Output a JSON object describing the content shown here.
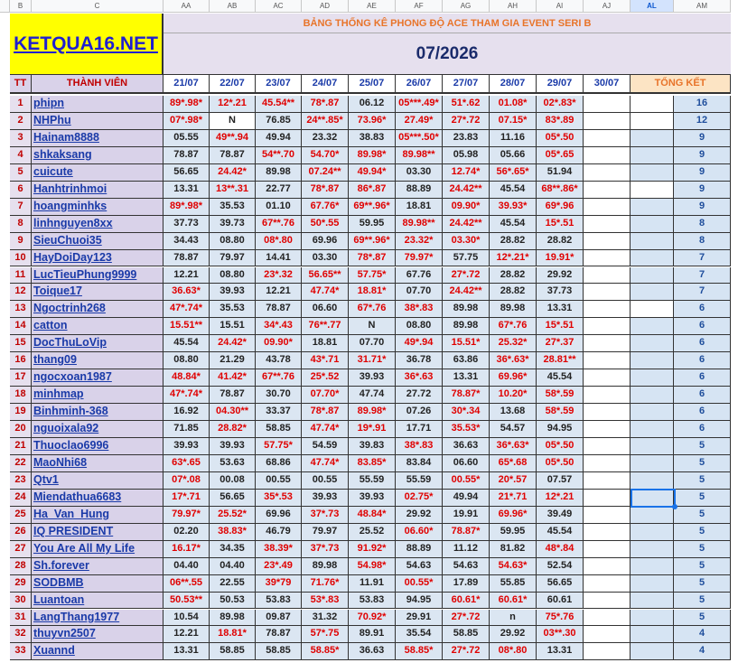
{
  "column_headers": [
    "B",
    "C",
    "AA",
    "AB",
    "AC",
    "AD",
    "AE",
    "AF",
    "AG",
    "AH",
    "AI",
    "AJ",
    "AL",
    "AM"
  ],
  "logo": "KETQUA16.NET",
  "title": "BẢNG THỐNG KÊ PHONG ĐỘ ACE THAM GIA EVENT SERI B",
  "month": "07/2026",
  "headers": {
    "tt": "TT",
    "member": "THÀNH VIÊN",
    "dates": [
      "21/07",
      "22/07",
      "23/07",
      "24/07",
      "25/07",
      "26/07",
      "27/07",
      "28/07",
      "29/07",
      "30/07"
    ],
    "total": "TỔNG KẾT"
  },
  "rows": [
    {
      "tt": "1",
      "name": "phipn",
      "vals": [
        "89*.98*",
        "12*.21",
        "45.54**",
        "78*.87",
        "06.12",
        "05***.49*",
        "51*.62",
        "01.08*",
        "02*.83*",
        ""
      ],
      "total": "16"
    },
    {
      "tt": "2",
      "name": "NHPhu",
      "vals": [
        "07*.98*",
        "N",
        "76.85",
        "24**.85*",
        "73.96*",
        "27.49*",
        "27*.72",
        "07.15*",
        "83*.89",
        ""
      ],
      "total": "12"
    },
    {
      "tt": "3",
      "name": "Hainam8888",
      "vals": [
        "05.55",
        "49**.94",
        "49.94",
        "23.32",
        "38.83",
        "05***.50*",
        "23.83",
        "11.16",
        "05*.50",
        ""
      ],
      "total": "9"
    },
    {
      "tt": "4",
      "name": "shkaksang",
      "vals": [
        "78.87",
        "78.87",
        "54**.70",
        "54.70*",
        "89.98*",
        "89.98**",
        "05.98",
        "05.66",
        "05*.65",
        ""
      ],
      "total": "9"
    },
    {
      "tt": "5",
      "name": "cuicute",
      "vals": [
        "56.65",
        "24.42*",
        "89.98",
        "07.24**",
        "49.94*",
        "03.30",
        "12.74*",
        "56*.65*",
        "51.94",
        ""
      ],
      "total": "9"
    },
    {
      "tt": "6",
      "name": "Hanhtrinhmoi",
      "vals": [
        "13.31",
        "13**.31",
        "22.77",
        "78*.87",
        "86*.87",
        "88.89",
        "24.42**",
        "45.54",
        "68**.86*",
        ""
      ],
      "total": "9"
    },
    {
      "tt": "7",
      "name": "hoangminhks",
      "vals": [
        "89*.98*",
        "35.53",
        "01.10",
        "67.76*",
        "69**.96*",
        "18.81",
        "09.90*",
        "39.93*",
        "69*.96",
        ""
      ],
      "total": "9"
    },
    {
      "tt": "8",
      "name": "linhnguyen8xx",
      "vals": [
        "37.73",
        "39.73",
        "67**.76",
        "50*.55",
        "59.95",
        "89.98**",
        "24.42**",
        "45.54",
        "15*.51",
        ""
      ],
      "total": "8"
    },
    {
      "tt": "9",
      "name": "SieuChuoi35",
      "vals": [
        "34.43",
        "08.80",
        "08*.80",
        "69.96",
        "69**.96*",
        "23.32*",
        "03.30*",
        "28.82",
        "28.82",
        ""
      ],
      "total": "8"
    },
    {
      "tt": "10",
      "name": "HayDoiDay123",
      "vals": [
        "78.87",
        "79.97",
        "14.41",
        "03.30",
        "78*.87",
        "79.97*",
        "57.75",
        "12*.21*",
        "19.91*",
        ""
      ],
      "total": "7"
    },
    {
      "tt": "11",
      "name": "LucTieuPhung9999",
      "vals": [
        "12.21",
        "08.80",
        "23*.32",
        "56.65**",
        "57.75*",
        "67.76",
        "27*.72",
        "28.82",
        "29.92",
        ""
      ],
      "total": "7"
    },
    {
      "tt": "12",
      "name": "Toique17",
      "vals": [
        "36.63*",
        "39.93",
        "12.21",
        "47.74*",
        "18.81*",
        "07.70",
        "24.42**",
        "28.82",
        "37.73",
        ""
      ],
      "total": "7"
    },
    {
      "tt": "13",
      "name": "Ngoctrinh268",
      "vals": [
        "47*.74*",
        "35.53",
        "78.87",
        "06.60",
        "67*.76",
        "38*.83",
        "89.98",
        "89.98",
        "13.31",
        ""
      ],
      "total": "6"
    },
    {
      "tt": "14",
      "name": "catton",
      "vals": [
        "15.51**",
        "15.51",
        "34*.43",
        "76**.77",
        "N",
        "08.80",
        "89.98",
        "67*.76",
        "15*.51",
        ""
      ],
      "total": "6"
    },
    {
      "tt": "15",
      "name": "DocThuLoVip",
      "vals": [
        "45.54",
        "24.42*",
        "09.90*",
        "18.81",
        "07.70",
        "49*.94",
        "15.51*",
        "25.32*",
        "27*.37",
        ""
      ],
      "total": "6"
    },
    {
      "tt": "16",
      "name": "thang09",
      "vals": [
        "08.80",
        "21.29",
        "43.78",
        "43*.71",
        "31.71*",
        "36.78",
        "63.86",
        "36*.63*",
        "28.81**",
        ""
      ],
      "total": "6"
    },
    {
      "tt": "17",
      "name": "ngocxoan1987",
      "vals": [
        "48.84*",
        "41.42*",
        "67**.76",
        "25*.52",
        "39.93",
        "36*.63",
        "13.31",
        "69.96*",
        "45.54",
        ""
      ],
      "total": "6"
    },
    {
      "tt": "18",
      "name": "minhmap",
      "vals": [
        "47*.74*",
        "78.87",
        "30.70",
        "07.70*",
        "47.74",
        "27.72",
        "78.87*",
        "10.20*",
        "58*.59",
        ""
      ],
      "total": "6"
    },
    {
      "tt": "19",
      "name": "Binhminh-368",
      "vals": [
        "16.92",
        "04.30**",
        "33.37",
        "78*.87",
        "89.98*",
        "07.26",
        "30*.34",
        "13.68",
        "58*.59",
        ""
      ],
      "total": "6"
    },
    {
      "tt": "20",
      "name": "nguoixala92",
      "vals": [
        "71.85",
        "28.82*",
        "58.85",
        "47.74*",
        "19*.91",
        "17.71",
        "35.53*",
        "54.57",
        "94.95",
        ""
      ],
      "total": "6"
    },
    {
      "tt": "21",
      "name": "Thuoclao6996",
      "vals": [
        "39.93",
        "39.93",
        "57.75*",
        "54.59",
        "39.83",
        "38*.83",
        "36.63",
        "36*.63*",
        "05*.50",
        ""
      ],
      "total": "5"
    },
    {
      "tt": "22",
      "name": "MaoNhi68",
      "vals": [
        "63*.65",
        "53.63",
        "68.86",
        "47.74*",
        "83.85*",
        "83.84",
        "06.60",
        "65*.68",
        "05*.50",
        ""
      ],
      "total": "5"
    },
    {
      "tt": "23",
      "name": "Qtv1",
      "vals": [
        "07*.08",
        "00.08",
        "00.55",
        "00.55",
        "55.59",
        "55.59",
        "00.55*",
        "20*.57",
        "07.57",
        ""
      ],
      "total": "5"
    },
    {
      "tt": "24",
      "name": "Miendathua6683",
      "vals": [
        "17*.71",
        "56.65",
        "35*.53",
        "39.93",
        "39.93",
        "02.75*",
        "49.94",
        "21*.71",
        "12*.21",
        ""
      ],
      "total": "5"
    },
    {
      "tt": "25",
      "name": "Ha_Van_Hung",
      "vals": [
        "79.97*",
        "25.52*",
        "69.96",
        "37*.73",
        "48.84*",
        "29.92",
        "19.91",
        "69.96*",
        "39.49",
        ""
      ],
      "total": "5"
    },
    {
      "tt": "26",
      "name": "IQ PRESIDENT",
      "vals": [
        "02.20",
        "38.83*",
        "46.79",
        "79.97",
        "25.52",
        "06.60*",
        "78.87*",
        "59.95",
        "45.54",
        ""
      ],
      "total": "5"
    },
    {
      "tt": "27",
      "name": "You Are All My Life",
      "vals": [
        "16.17*",
        "34.35",
        "38.39*",
        "37*.73",
        "91.92*",
        "88.89",
        "11.12",
        "81.82",
        "48*.84",
        ""
      ],
      "total": "5"
    },
    {
      "tt": "28",
      "name": "Sh.forever",
      "vals": [
        "04.40",
        "04.40",
        "23*.49",
        "89.98",
        "54.98*",
        "54.63",
        "54.63",
        "54.63*",
        "52.54",
        ""
      ],
      "total": "5"
    },
    {
      "tt": "29",
      "name": "SODBMB",
      "vals": [
        "06**.55",
        "22.55",
        "39*79",
        "71.76*",
        "11.91",
        "00.55*",
        "17.89",
        "55.85",
        "56.65",
        ""
      ],
      "total": "5"
    },
    {
      "tt": "30",
      "name": "Luantoan",
      "vals": [
        "50.53**",
        "50.53",
        "53.83",
        "53*.83",
        "53.83",
        "94.95",
        "60.61*",
        "60.61*",
        "60.61",
        ""
      ],
      "total": "5"
    },
    {
      "tt": "31",
      "name": "LangThang1977",
      "vals": [
        "10.54",
        "89.98",
        "09.87",
        "31.32",
        "70.92*",
        "29.91",
        "27*.72",
        "n",
        "75*.76",
        ""
      ],
      "total": "5"
    },
    {
      "tt": "32",
      "name": "thuyvn2507",
      "vals": [
        "12.21",
        "18.81*",
        "78.87",
        "57*.75",
        "89.91",
        "35.54",
        "58.85",
        "29.92",
        "03**.30",
        ""
      ],
      "total": "4"
    },
    {
      "tt": "33",
      "name": "Xuannd",
      "vals": [
        "13.31",
        "58.85",
        "58.85",
        "58.85*",
        "36.63",
        "58.85*",
        "27*.72",
        "08*.80",
        "13.31",
        ""
      ],
      "total": "4"
    }
  ]
}
